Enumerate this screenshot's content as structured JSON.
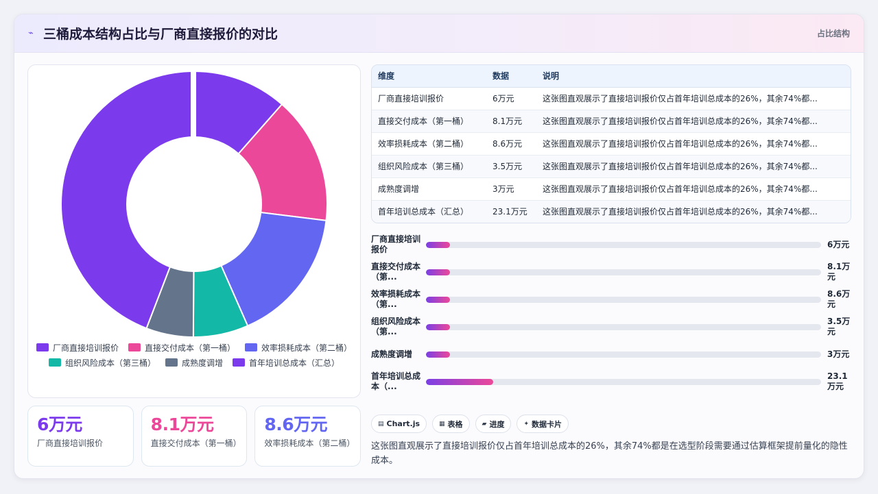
{
  "header": {
    "title": "三桶成本结构占比与厂商直接报价的对比",
    "tag": "占比结构"
  },
  "colors": {
    "purple": "#7c3aed",
    "pink": "#ec4899",
    "indigo": "#6366f1",
    "teal": "#14b8a6",
    "slate": "#64748b"
  },
  "chart_data": {
    "type": "pie",
    "labels": [
      "厂商直接培训报价",
      "直接交付成本（第一桶）",
      "效率损耗成本（第二桶）",
      "组织风险成本（第三桶）",
      "成熟度调增",
      "首年培训总成本（汇总）"
    ],
    "values": [
      6,
      8.1,
      8.6,
      3.5,
      3,
      23.1
    ],
    "colors": [
      "#7c3aed",
      "#ec4899",
      "#6366f1",
      "#14b8a6",
      "#64748b",
      "#7c3aed"
    ],
    "legend_position": "bottom"
  },
  "table": {
    "headers": [
      "维度",
      "数据",
      "说明"
    ],
    "rows": [
      [
        "厂商直接培训报价",
        "6万元",
        "这张图直观展示了直接培训报价仅占首年培训总成本的26%，其余74%都..."
      ],
      [
        "直接交付成本（第一桶）",
        "8.1万元",
        "这张图直观展示了直接培训报价仅占首年培训总成本的26%，其余74%都..."
      ],
      [
        "效率损耗成本（第二桶）",
        "8.6万元",
        "这张图直观展示了直接培训报价仅占首年培训总成本的26%，其余74%都..."
      ],
      [
        "组织风险成本（第三桶）",
        "3.5万元",
        "这张图直观展示了直接培训报价仅占首年培训总成本的26%，其余74%都..."
      ],
      [
        "成熟度调增",
        "3万元",
        "这张图直观展示了直接培训报价仅占首年培训总成本的26%，其余74%都..."
      ],
      [
        "首年培训总成本（汇总）",
        "23.1万元",
        "这张图直观展示了直接培训报价仅占首年培训总成本的26%，其余74%都..."
      ]
    ]
  },
  "progress": [
    {
      "label": "厂商直接培训报价",
      "value": "6万元",
      "fraction": 0.06
    },
    {
      "label": "直接交付成本（第...",
      "value": "8.1万元",
      "fraction": 0.06
    },
    {
      "label": "效率损耗成本（第...",
      "value": "8.6万元",
      "fraction": 0.06
    },
    {
      "label": "组织风险成本（第...",
      "value": "3.5万元",
      "fraction": 0.06
    },
    {
      "label": "成熟度调增",
      "value": "3万元",
      "fraction": 0.06
    },
    {
      "label": "首年培训总成本（...",
      "value": "23.1万元",
      "fraction": 0.17
    }
  ],
  "kpis": [
    {
      "value": "6万元",
      "label": "厂商直接培训报价",
      "color": "#7c3aed"
    },
    {
      "value": "8.1万元",
      "label": "直接交付成本（第一桶）",
      "color": "#ec4899"
    },
    {
      "value": "8.6万元",
      "label": "效率损耗成本（第二桶）",
      "color": "#6366f1"
    }
  ],
  "chips": [
    {
      "icon": "chart-icon",
      "label": "Chart.js"
    },
    {
      "icon": "table-icon",
      "label": "表格"
    },
    {
      "icon": "progress-icon",
      "label": "进度"
    },
    {
      "icon": "sparkle-icon",
      "label": "数据卡片"
    }
  ],
  "description": "这张图直观展示了直接培训报价仅占首年培训总成本的26%，其余74%都是在选型阶段需要通过估算框架提前量化的隐性成本。"
}
